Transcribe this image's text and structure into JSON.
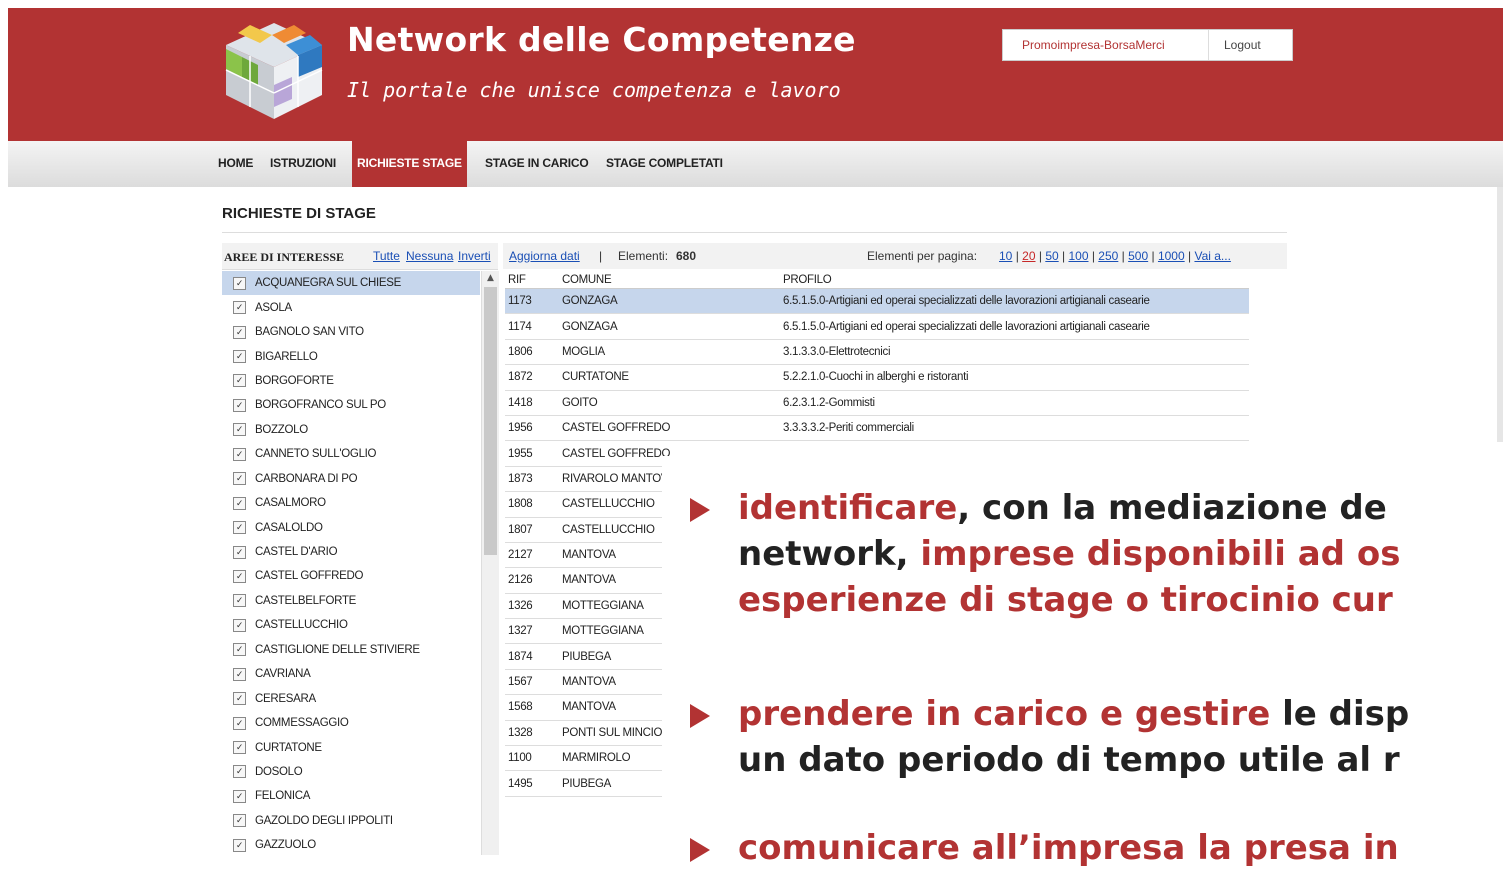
{
  "header": {
    "title": "Network delle Competenze",
    "subtitle": "Il portale che unisce competenza e lavoro",
    "user": "Promoimpresa-BorsaMerci",
    "logout": "Logout"
  },
  "nav": [
    "HOME",
    "ISTRUZIONI",
    "RICHIESTE STAGE",
    "STAGE IN CARICO",
    "STAGE COMPLETATI"
  ],
  "nav_active": "RICHIESTE STAGE",
  "page_title": "RICHIESTE DI STAGE",
  "left_panel": {
    "header": "AREE DI INTERESSE",
    "links": [
      "Tutte",
      "Nessuna",
      "Inverti"
    ],
    "items": [
      "ACQUANEGRA SUL CHIESE",
      "ASOLA",
      "BAGNOLO SAN VITO",
      "BIGARELLO",
      "BORGOFORTE",
      "BORGOFRANCO SUL PO",
      "BOZZOLO",
      "CANNETO SULL'OGLIO",
      "CARBONARA DI PO",
      "CASALMORO",
      "CASALOLDO",
      "CASTEL D'ARIO",
      "CASTEL GOFFREDO",
      "CASTELBELFORTE",
      "CASTELLUCCHIO",
      "CASTIGLIONE DELLE STIVIERE",
      "CAVRIANA",
      "CERESARA",
      "COMMESSAGGIO",
      "CURTATONE",
      "DOSOLO",
      "FELONICA",
      "GAZOLDO DEGLI IPPOLITI",
      "GAZZUOLO"
    ],
    "selected_index": 0
  },
  "toolbar": {
    "refresh": "Aggiorna dati",
    "sep": "|",
    "count_label": "Elementi:",
    "count": "680",
    "per_page_label": "Elementi per pagina:",
    "per_page": [
      "10",
      "20",
      "50",
      "100",
      "250",
      "500",
      "1000",
      "Vai a..."
    ],
    "per_page_current": "20"
  },
  "table": {
    "columns": [
      "RIF",
      "COMUNE",
      "PROFILO"
    ],
    "rows": [
      [
        "1173",
        "GONZAGA",
        "6.5.1.5.0-Artigiani ed operai specializzati delle lavorazioni artigianali casearie"
      ],
      [
        "1174",
        "GONZAGA",
        "6.5.1.5.0-Artigiani ed operai specializzati delle lavorazioni artigianali casearie"
      ],
      [
        "1806",
        "MOGLIA",
        "3.1.3.3.0-Elettrotecnici"
      ],
      [
        "1872",
        "CURTATONE",
        "5.2.2.1.0-Cuochi in alberghi e ristoranti"
      ],
      [
        "1418",
        "GOITO",
        "6.2.3.1.2-Gommisti"
      ],
      [
        "1956",
        "CASTEL GOFFREDO",
        "3.3.3.3.2-Periti commerciali"
      ],
      [
        "1955",
        "CASTEL GOFFREDO",
        ""
      ],
      [
        "1873",
        "RIVAROLO MANTOVANO",
        ""
      ],
      [
        "1808",
        "CASTELLUCCHIO",
        ""
      ],
      [
        "1807",
        "CASTELLUCCHIO",
        ""
      ],
      [
        "2127",
        "MANTOVA",
        ""
      ],
      [
        "2126",
        "MANTOVA",
        ""
      ],
      [
        "1326",
        "MOTTEGGIANA",
        ""
      ],
      [
        "1327",
        "MOTTEGGIANA",
        ""
      ],
      [
        "1874",
        "PIUBEGA",
        ""
      ],
      [
        "1567",
        "MANTOVA",
        ""
      ],
      [
        "1568",
        "MANTOVA",
        ""
      ],
      [
        "1328",
        "PONTI SUL MINCIO",
        ""
      ],
      [
        "1100",
        "MARMIROLO",
        ""
      ],
      [
        "1495",
        "PIUBEGA",
        ""
      ]
    ],
    "selected_index": 0
  },
  "bullets": [
    {
      "lines": [
        [
          {
            "t": "identificare",
            "red": true
          },
          {
            "t": ", con la mediazione de",
            "red": false
          }
        ],
        [
          {
            "t": "network, ",
            "red": false
          },
          {
            "t": "imprese disponibili ad os",
            "red": true
          }
        ],
        [
          {
            "t": "esperienze di stage o tirocinio cur",
            "red": true
          }
        ]
      ]
    },
    {
      "lines": [
        [
          {
            "t": "prendere in carico e gestire",
            "red": true
          },
          {
            "t": " le disp",
            "red": false
          }
        ],
        [
          {
            "t": "un dato periodo di tempo utile al r",
            "red": false
          }
        ]
      ]
    },
    {
      "lines": [
        [
          {
            "t": "comunicare all’impresa la presa in",
            "red": true
          }
        ]
      ]
    }
  ]
}
